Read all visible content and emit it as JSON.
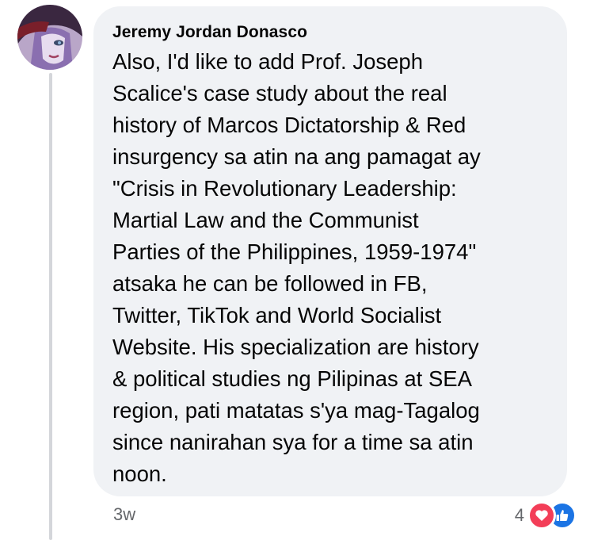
{
  "comment": {
    "author": "Jeremy Jordan Donasco",
    "text": "Also, I'd like to add Prof. Joseph\nScalice's case study about the real\nhistory of Marcos Dictatorship & Red\ninsurgency sa atin na ang pamagat ay\n\"Crisis in Revolutionary Leadership:\nMartial Law and the Communist\nParties of the Philippines, 1959-1974\"\natsaka he can be followed in FB,\nTwitter, TikTok and World Socialist\nWebsite. His specialization are history\n& political studies ng Pilipinas at SEA\nregion, pati matatas s'ya mag-Tagalog\nsince nanirahan sya for a time sa atin\nnoon.",
    "timestamp": "3w",
    "reactions": {
      "count": "4",
      "icons": [
        "heart-icon",
        "like-icon"
      ]
    }
  },
  "colors": {
    "bubble": "#f0f2f5",
    "heart": "#f33e58",
    "like": "#1b74e4",
    "meta_text": "#65676b"
  }
}
